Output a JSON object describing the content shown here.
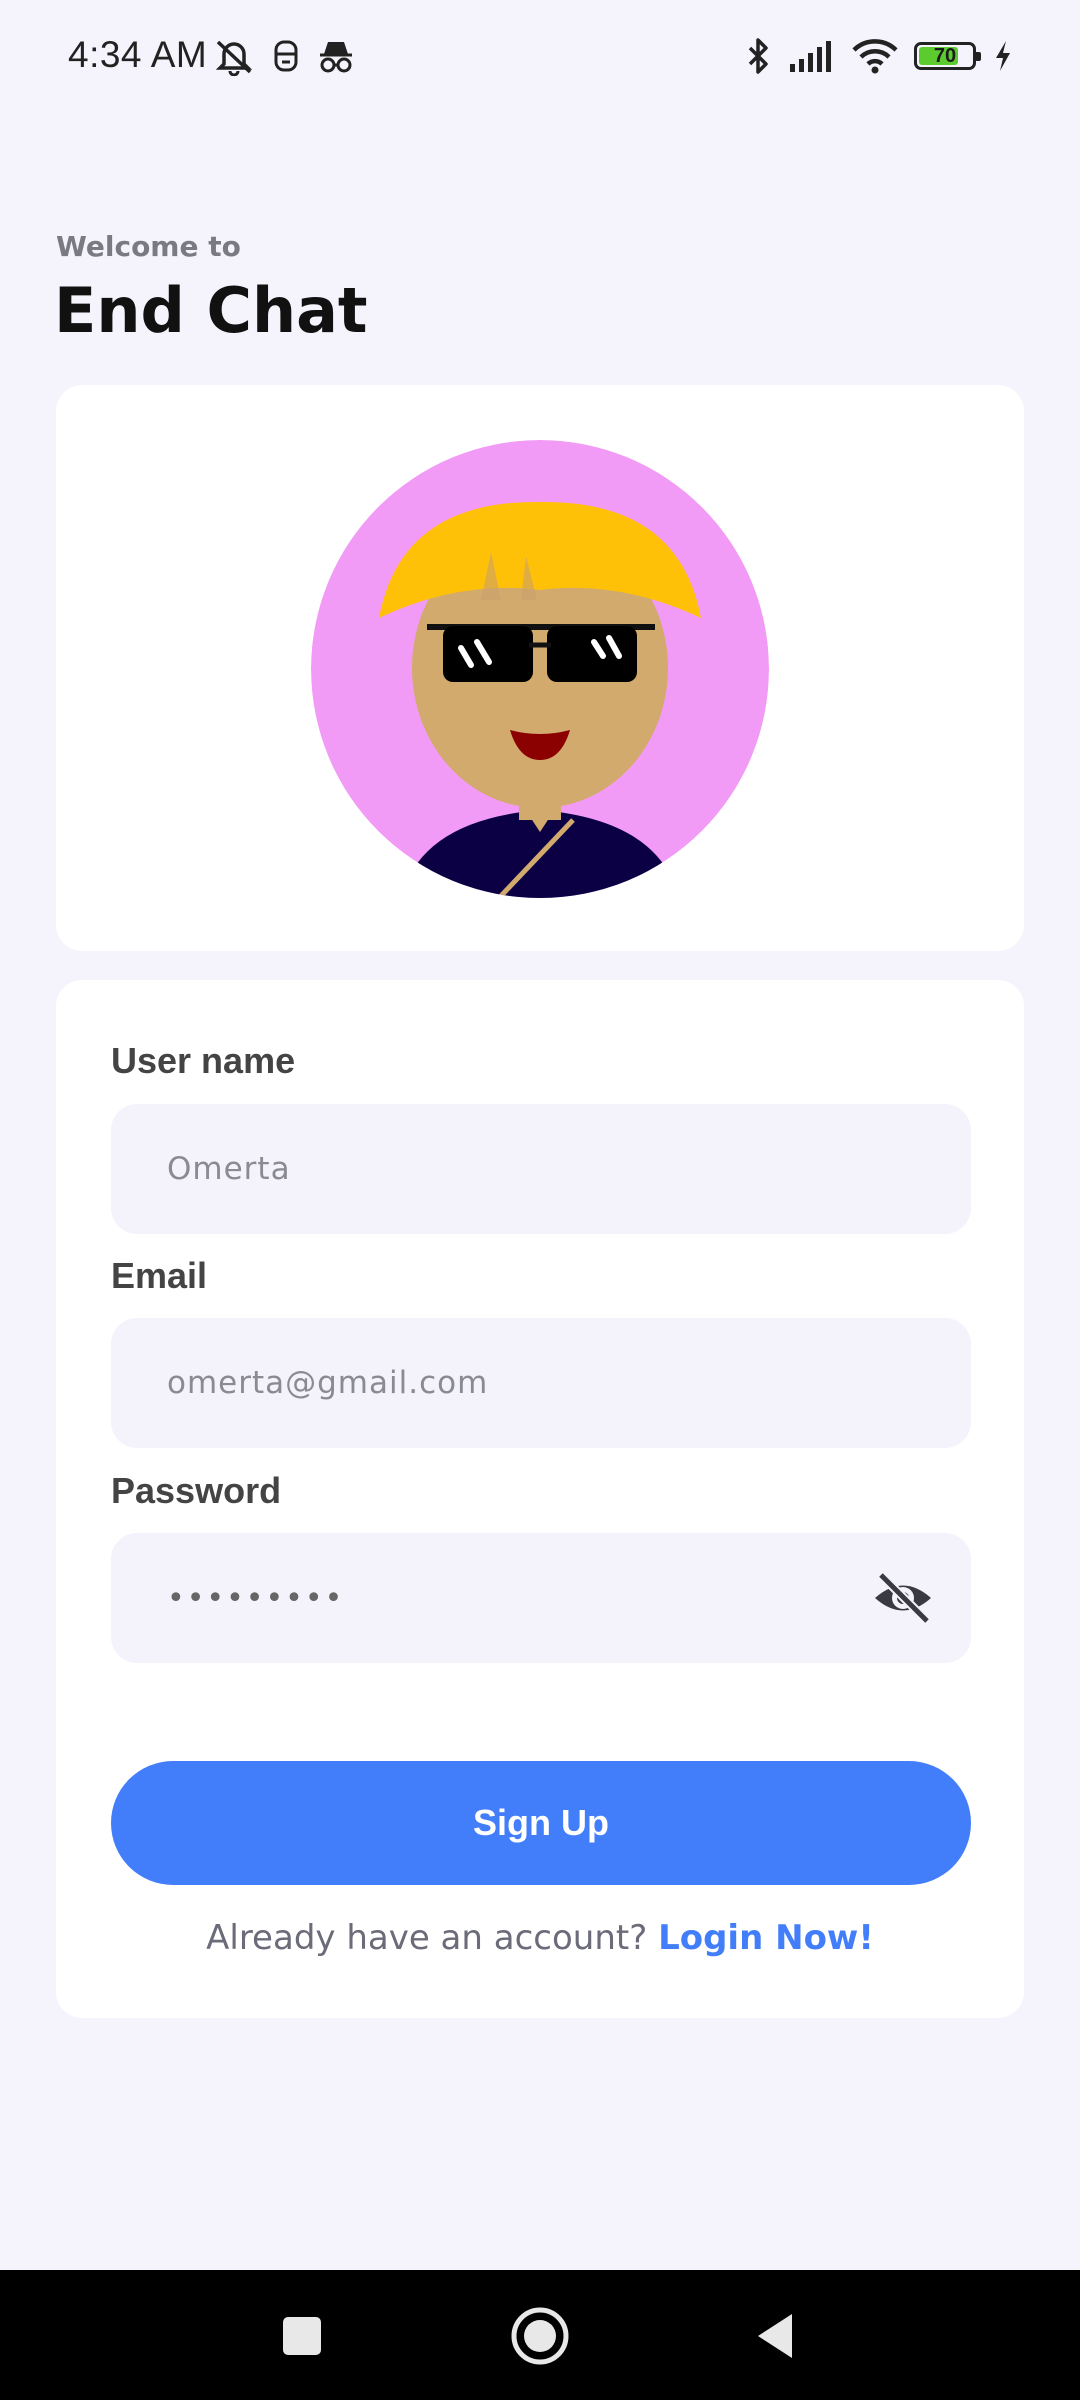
{
  "status_bar": {
    "time": "4:34 AM",
    "left_icons": [
      "alarm-off-icon",
      "face-scan-icon",
      "incognito-icon"
    ],
    "right_icons": [
      "bluetooth-icon",
      "signal-icon",
      "wifi-icon",
      "battery-icon",
      "charging-icon"
    ],
    "battery_percent": "70",
    "battery_color": "#5CCB2E"
  },
  "header": {
    "welcome": "Welcome to",
    "title": "End Chat"
  },
  "avatar": {
    "icon": "avatar-with-sunglasses",
    "background_color": "#F29BF6"
  },
  "form": {
    "username": {
      "label": "User name",
      "value": "Omerta"
    },
    "email": {
      "label": "Email",
      "value": "omerta@gmail.com"
    },
    "password": {
      "label": "Password",
      "value": "•••••••••",
      "toggle_icon": "eye-off-icon"
    },
    "submit_label": "Sign Up",
    "login_prompt": "Already have an account?",
    "login_link": "Login Now!"
  },
  "nav_bar": {
    "buttons": [
      "recents-square-icon",
      "home-circle-icon",
      "back-triangle-icon"
    ]
  },
  "colors": {
    "background": "#F5F4FD",
    "accent": "#437EFA",
    "field_background": "#F4F3FC"
  }
}
